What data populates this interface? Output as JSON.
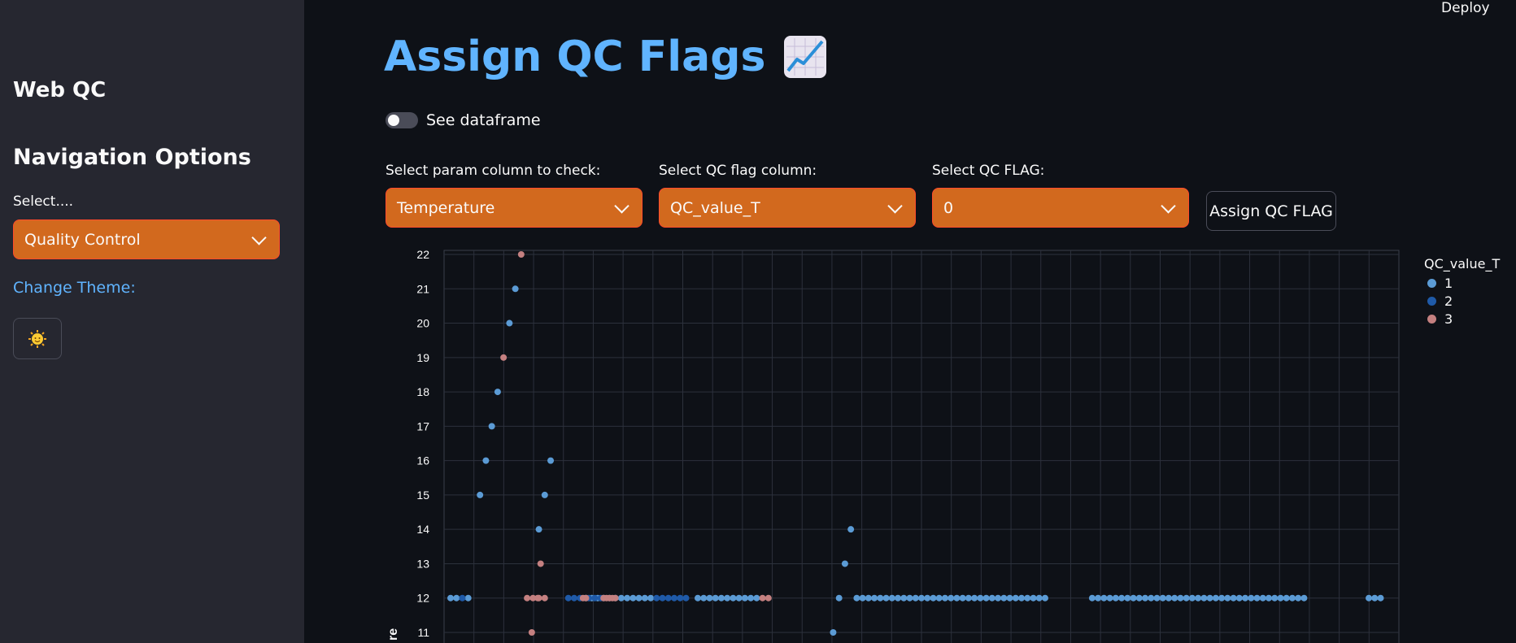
{
  "sidebar": {
    "app_title": "Web QC",
    "nav_title": "Navigation Options",
    "select_label": "Select....",
    "select_value": "Quality Control",
    "theme_label": "Change Theme:",
    "theme_icon": "sun-face-icon"
  },
  "header": {
    "deploy_label": "Deploy"
  },
  "main": {
    "title": "Assign QC Flags",
    "title_icon": "chart-increasing-icon",
    "toggle_label": "See dataframe",
    "toggle_on": false,
    "param_label": "Select param column to check:",
    "param_value": "Temperature",
    "flagcol_label": "Select QC flag column:",
    "flagcol_value": "QC_value_T",
    "flag_label": "Select QC FLAG:",
    "flag_value": "0",
    "assign_button": "Assign QC FLAG"
  },
  "colors": {
    "accent": "#60b4ff",
    "select_bg": "#d2691e",
    "flag1": "#5b9bd5",
    "flag2": "#1f5aa8",
    "flag3": "#c48080"
  },
  "chart_data": {
    "type": "scatter",
    "ylabel": "re",
    "y_ticks": [
      11,
      12,
      13,
      14,
      15,
      16,
      17,
      18,
      19,
      20,
      21,
      22
    ],
    "legend_title": "QC_value_T",
    "series": [
      {
        "name": "1",
        "color": "#5b9bd5",
        "points": [
          [
            0,
            12
          ],
          [
            1,
            12
          ],
          [
            3,
            12
          ],
          [
            5,
            15
          ],
          [
            6,
            16
          ],
          [
            7,
            17
          ],
          [
            8,
            18
          ],
          [
            10,
            20
          ],
          [
            11,
            21
          ],
          [
            17,
            16
          ],
          [
            23,
            12
          ],
          [
            24,
            12
          ],
          [
            25,
            12
          ],
          [
            26,
            12
          ],
          [
            27,
            12
          ],
          [
            28,
            12
          ],
          [
            29,
            12
          ],
          [
            30,
            12
          ],
          [
            31,
            12
          ],
          [
            32,
            12
          ],
          [
            33,
            12
          ],
          [
            34,
            12
          ],
          [
            42,
            12
          ],
          [
            43,
            12
          ],
          [
            44,
            12
          ],
          [
            45,
            12
          ],
          [
            46,
            12
          ],
          [
            47,
            12
          ],
          [
            48,
            12
          ],
          [
            49,
            12
          ],
          [
            50,
            12
          ],
          [
            51,
            12
          ],
          [
            52,
            12
          ],
          [
            65,
            11
          ],
          [
            66,
            12
          ],
          [
            67,
            13
          ],
          [
            68,
            14
          ],
          [
            69,
            12
          ],
          [
            70,
            12
          ],
          [
            71,
            12
          ],
          [
            72,
            12
          ],
          [
            73,
            12
          ],
          [
            74,
            12
          ],
          [
            75,
            12
          ],
          [
            76,
            12
          ],
          [
            77,
            12
          ],
          [
            78,
            12
          ],
          [
            79,
            12
          ],
          [
            80,
            12
          ],
          [
            81,
            12
          ],
          [
            82,
            12
          ],
          [
            83,
            12
          ],
          [
            84,
            12
          ],
          [
            85,
            12
          ],
          [
            86,
            12
          ],
          [
            87,
            12
          ],
          [
            88,
            12
          ],
          [
            89,
            12
          ],
          [
            90,
            12
          ],
          [
            91,
            12
          ],
          [
            92,
            12
          ],
          [
            93,
            12
          ],
          [
            94,
            12
          ],
          [
            95,
            12
          ],
          [
            96,
            12
          ],
          [
            97,
            12
          ],
          [
            98,
            12
          ],
          [
            99,
            12
          ],
          [
            100,
            12
          ],
          [
            101,
            12
          ],
          [
            109,
            12
          ],
          [
            110,
            12
          ],
          [
            111,
            12
          ],
          [
            112,
            12
          ],
          [
            113,
            12
          ],
          [
            114,
            12
          ],
          [
            115,
            12
          ],
          [
            116,
            12
          ],
          [
            117,
            12
          ],
          [
            118,
            12
          ],
          [
            119,
            12
          ],
          [
            120,
            12
          ],
          [
            121,
            12
          ],
          [
            122,
            12
          ],
          [
            123,
            12
          ],
          [
            124,
            12
          ],
          [
            125,
            12
          ],
          [
            126,
            12
          ],
          [
            127,
            12
          ],
          [
            128,
            12
          ],
          [
            129,
            12
          ],
          [
            130,
            12
          ],
          [
            131,
            12
          ],
          [
            132,
            12
          ],
          [
            133,
            12
          ],
          [
            134,
            12
          ],
          [
            135,
            12
          ],
          [
            136,
            12
          ],
          [
            137,
            12
          ],
          [
            138,
            12
          ],
          [
            139,
            12
          ],
          [
            140,
            12
          ],
          [
            141,
            12
          ],
          [
            142,
            12
          ],
          [
            143,
            12
          ],
          [
            144,
            12
          ],
          [
            145,
            12
          ],
          [
            156,
            12
          ],
          [
            157,
            12
          ],
          [
            158,
            12
          ],
          [
            15,
            14
          ],
          [
            16,
            15
          ]
        ]
      },
      {
        "name": "2",
        "color": "#1f5aa8",
        "points": [
          [
            2,
            12
          ],
          [
            20,
            12
          ],
          [
            21,
            12
          ],
          [
            22,
            12
          ],
          [
            23.5,
            12
          ],
          [
            24.5,
            12
          ],
          [
            25.5,
            12
          ],
          [
            35,
            12
          ],
          [
            36,
            12
          ],
          [
            37,
            12
          ],
          [
            38,
            12
          ],
          [
            39,
            12
          ],
          [
            40,
            12
          ]
        ]
      },
      {
        "name": "3",
        "color": "#c48080",
        "points": [
          [
            12,
            22
          ],
          [
            9,
            19
          ],
          [
            13,
            12
          ],
          [
            14,
            12
          ],
          [
            15,
            12
          ],
          [
            16,
            12
          ],
          [
            22.5,
            12
          ],
          [
            23,
            12.0
          ],
          [
            26.5,
            12
          ],
          [
            27.5,
            12
          ],
          [
            26,
            12.0
          ],
          [
            27,
            12.0
          ],
          [
            28,
            12.0
          ],
          [
            13.8,
            11
          ],
          [
            14.8,
            12
          ],
          [
            15.3,
            13
          ],
          [
            53,
            12
          ],
          [
            54,
            12
          ]
        ]
      }
    ]
  }
}
